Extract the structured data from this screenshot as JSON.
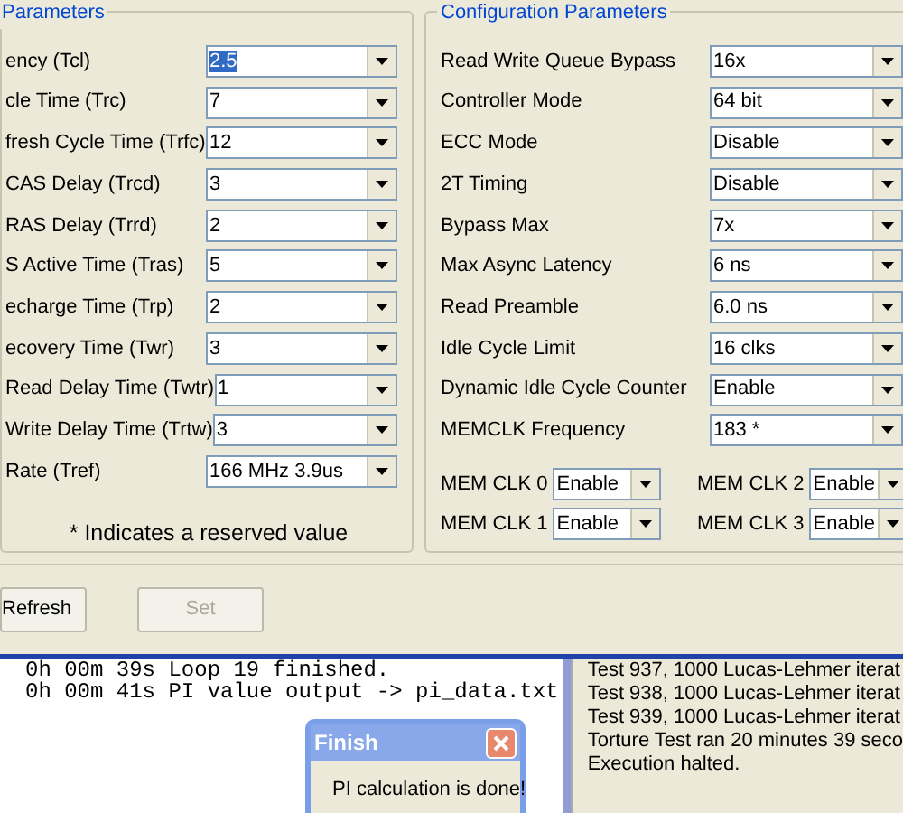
{
  "timing_group": {
    "title": "Parameters",
    "rows": [
      {
        "label": "ency (Tcl)",
        "value": "2.5",
        "selected": true
      },
      {
        "label": "cle Time (Trc)",
        "value": "7",
        "selected": false
      },
      {
        "label": "fresh Cycle Time (Trfc)",
        "value": "12",
        "selected": false
      },
      {
        "label": "CAS Delay (Trcd)",
        "value": "3",
        "selected": false
      },
      {
        "label": "RAS Delay (Trrd)",
        "value": "2",
        "selected": false
      },
      {
        "label": "S Active Time (Tras)",
        "value": "5",
        "selected": false
      },
      {
        "label": "echarge Time (Trp)",
        "value": "2",
        "selected": false
      },
      {
        "label": "ecovery Time (Twr)",
        "value": "3",
        "selected": false
      },
      {
        "label": "Read Delay Time (Twtr)",
        "value": "1",
        "selected": false
      },
      {
        "label": "Write Delay Time (Trtw)",
        "value": "3",
        "selected": false
      },
      {
        "label": "Rate (Tref)",
        "value": "166 MHz 3.9us",
        "selected": false
      }
    ],
    "note": "* Indicates a reserved value"
  },
  "config_group": {
    "title": "Configuration Parameters",
    "rows": [
      {
        "label": "Read Write Queue Bypass",
        "value": "16x"
      },
      {
        "label": "Controller Mode",
        "value": "64 bit"
      },
      {
        "label": "ECC Mode",
        "value": "Disable"
      },
      {
        "label": "2T Timing",
        "value": "Disable"
      },
      {
        "label": "Bypass Max",
        "value": "7x"
      },
      {
        "label": "Max Async Latency",
        "value": "6 ns"
      },
      {
        "label": "Read Preamble",
        "value": "6.0 ns"
      },
      {
        "label": "Idle Cycle Limit",
        "value": "16 clks"
      },
      {
        "label": "Dynamic Idle Cycle Counter",
        "value": "Enable"
      },
      {
        "label": "MEMCLK Frequency",
        "value": "183 *"
      }
    ],
    "mem_clks": [
      {
        "label": "MEM CLK 0",
        "value": "Enable"
      },
      {
        "label": "MEM CLK 2",
        "value": "Enable"
      },
      {
        "label": "MEM CLK 1",
        "value": "Enable"
      },
      {
        "label": "MEM CLK 3",
        "value": "Enable"
      }
    ]
  },
  "buttons": [
    {
      "label": "Refresh",
      "disabled": false
    },
    {
      "label": "Set",
      "disabled": true
    }
  ],
  "console": {
    "lines": [
      "0h 00m 39s Loop 19 finished.",
      "0h 00m 41s PI value output -> pi_data.txt"
    ]
  },
  "dialog": {
    "title": "Finish",
    "message": "PI calculation is done!"
  },
  "log": {
    "lines": [
      "Test 937, 1000 Lucas-Lehmer iterat",
      "Test 938, 1000 Lucas-Lehmer iterat",
      "Test 939, 1000 Lucas-Lehmer iterat",
      "Torture Test ran 20 minutes 39 seco",
      "Execution halted."
    ]
  }
}
